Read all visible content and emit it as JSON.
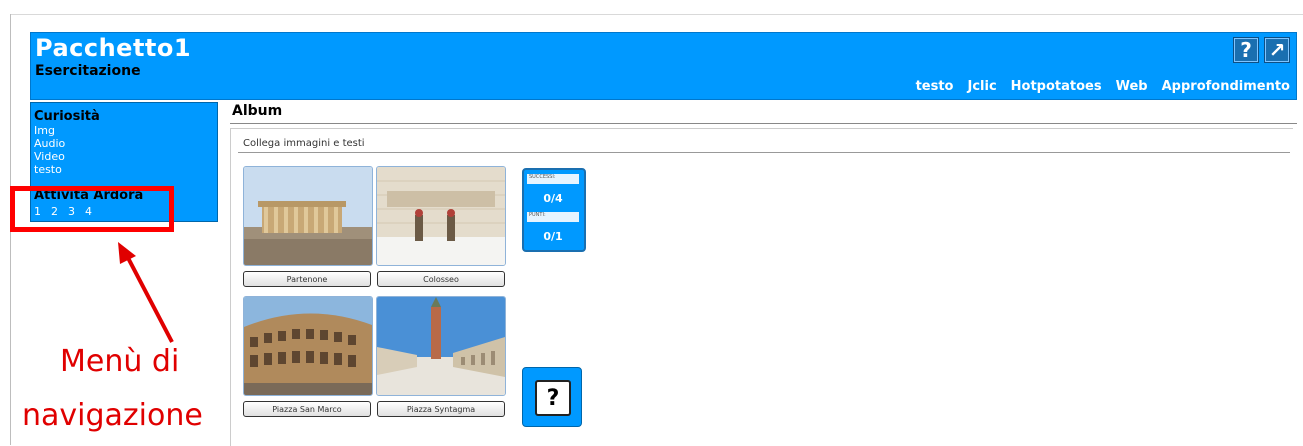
{
  "header": {
    "title": "Pacchetto1",
    "subtitle": "Esercitazione",
    "help_icon_glyph": "?",
    "open_icon_glyph": "↗",
    "nav": [
      "testo",
      "Jclic",
      "Hotpotatoes",
      "Web",
      "Approfondimento"
    ]
  },
  "sidebar": {
    "section1_title": "Curiosità",
    "links": [
      "Img",
      "Audio",
      "Video",
      "testo"
    ],
    "section2_title": "Attività Ardora",
    "activity_numbers": [
      "1",
      "2",
      "3",
      "4"
    ]
  },
  "content": {
    "title": "Album",
    "instruction": "Collega immagini e testi"
  },
  "cards": [
    {
      "label": "Partenone",
      "icon": "parthenon-image"
    },
    {
      "label": "Colosseo",
      "icon": "syntagma-guards-image"
    },
    {
      "label": "Piazza San Marco",
      "icon": "colosseum-image"
    },
    {
      "label": "Piazza Syntagma",
      "icon": "san-marco-image"
    }
  ],
  "score": {
    "success_label": "SUCCESSI:",
    "success_value": "0/4",
    "points_label": "PUNTI:",
    "points_value": "0/1"
  },
  "help_button": "?",
  "annotation": {
    "line1": "Menù di",
    "line2": "navigazione"
  },
  "colors": {
    "header_bg": "#0099ff",
    "highlight": "#ff0000",
    "annotation_text": "#e00000"
  }
}
